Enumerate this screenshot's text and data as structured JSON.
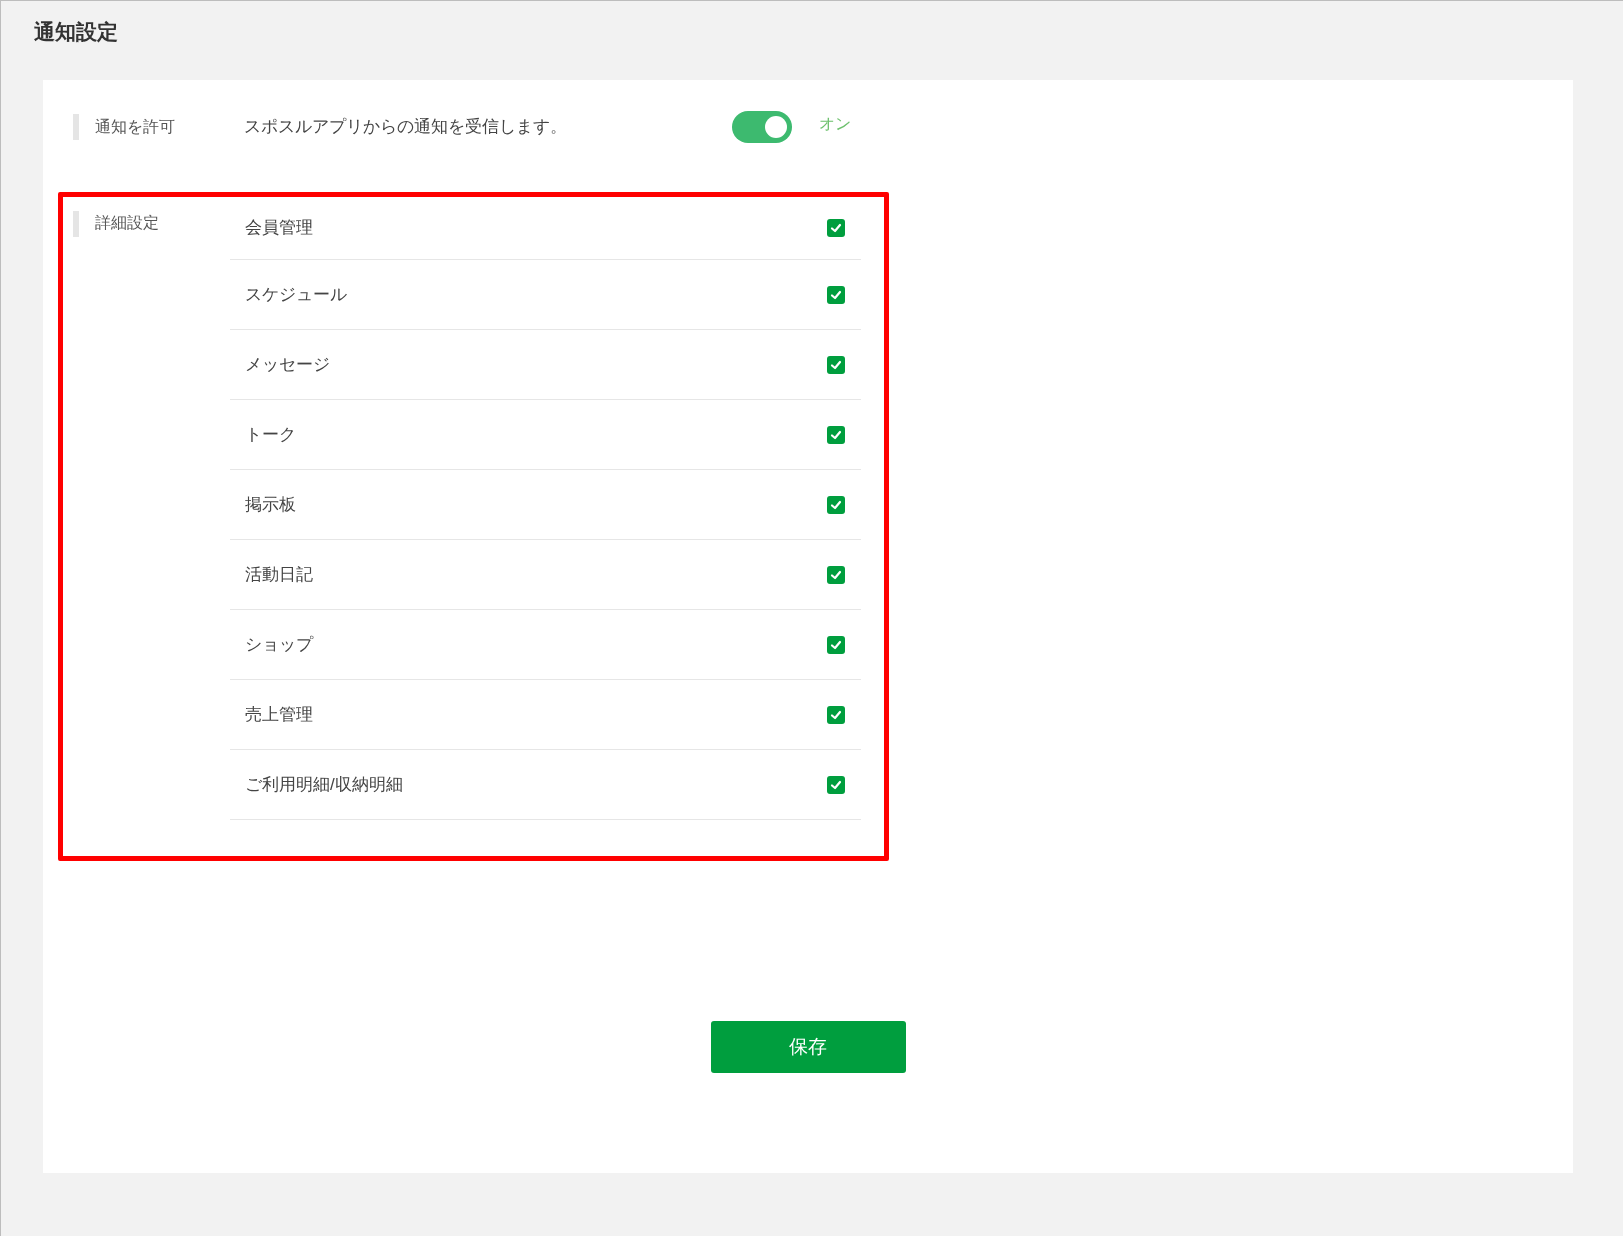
{
  "page_title": "通知設定",
  "permission": {
    "label": "通知を許可",
    "description": "スポスルアプリからの通知を受信します。",
    "on": true,
    "state_text": "オン"
  },
  "details": {
    "label": "詳細設定",
    "items": [
      {
        "label": "会員管理",
        "checked": true
      },
      {
        "label": "スケジュール",
        "checked": true
      },
      {
        "label": "メッセージ",
        "checked": true
      },
      {
        "label": "トーク",
        "checked": true
      },
      {
        "label": "掲示板",
        "checked": true
      },
      {
        "label": "活動日記",
        "checked": true
      },
      {
        "label": "ショップ",
        "checked": true
      },
      {
        "label": "売上管理",
        "checked": true
      },
      {
        "label": "ご利用明細/収納明細",
        "checked": true
      }
    ]
  },
  "save_button": "保存"
}
